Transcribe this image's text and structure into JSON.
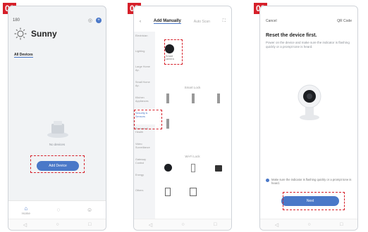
{
  "steps": [
    {
      "label": "01"
    },
    {
      "label": "02"
    },
    {
      "label": "03"
    }
  ],
  "phone1": {
    "status_left": "",
    "status_right": "",
    "home_selector": "180",
    "home_name": "Sunny",
    "weather": [
      {
        "value": "",
        "label": ""
      },
      {
        "value": "",
        "label": ""
      },
      {
        "value": "",
        "label": ""
      }
    ],
    "tabs": [
      {
        "label": "All Devices"
      },
      {
        "label": ""
      },
      {
        "label": ""
      },
      {
        "label": ""
      }
    ],
    "empty_text": "No devices",
    "add_device_label": "Add Device",
    "bottom_tabs": [
      {
        "label": "Home"
      },
      {
        "label": ""
      },
      {
        "label": ""
      }
    ],
    "accent": "#4a78c8"
  },
  "phone2": {
    "title": "Add Manually",
    "tab2": "Auto Scan",
    "sidebar": [
      "Electrician",
      "Lighting",
      "Large Home Ap.",
      "Small Home Ap.",
      "Kitchen Appliances",
      "Security & Sensors",
      "Exercise & Health",
      "Video Surveillance",
      "Gateway Control",
      "Energy",
      "Others"
    ],
    "groups": [
      "",
      "Smart Lock",
      "Wi-Fi Lock"
    ],
    "devices": [
      {
        "label": "Smart Camera"
      },
      {
        "label": ""
      },
      {
        "label": ""
      },
      {
        "label": ""
      },
      {
        "label": ""
      },
      {
        "label": ""
      },
      {
        "label": ""
      },
      {
        "label": ""
      },
      {
        "label": ""
      },
      {
        "label": ""
      }
    ]
  },
  "phone3": {
    "cancel": "Cancel",
    "mode": "QR Code",
    "title": "Reset the device first.",
    "description": "Power on the device and make sure the indicator is flashing quickly or a prompt tone is heard.",
    "link": "",
    "check_text": "Make sure the indicator is flashing quickly or a prompt tone is heard.",
    "next_label": "Next"
  }
}
